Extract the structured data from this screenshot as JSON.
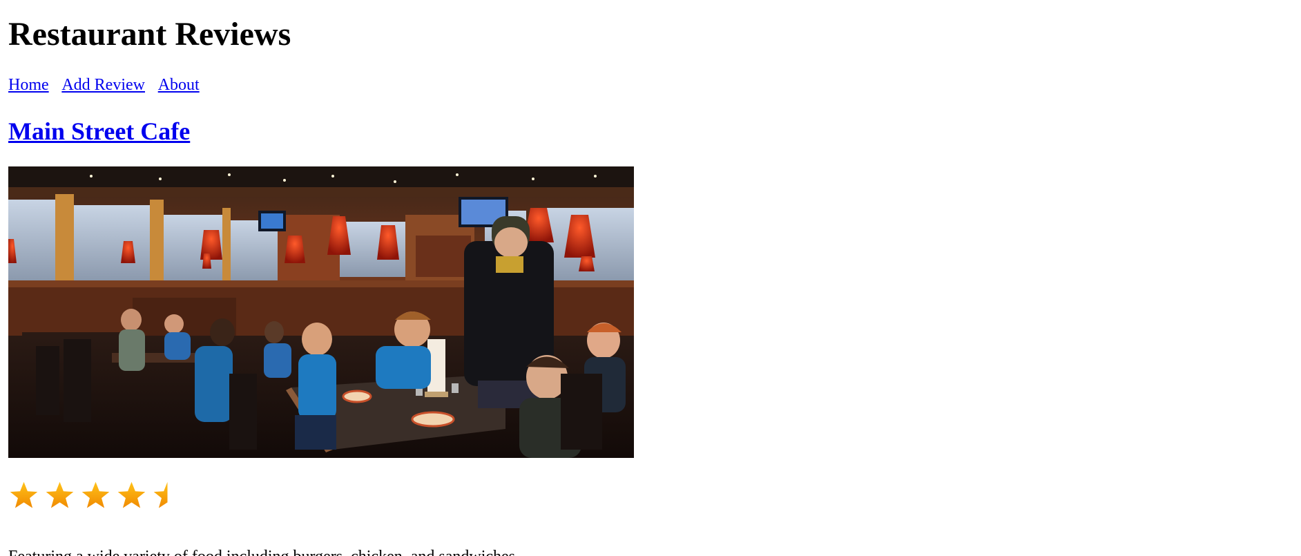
{
  "header": {
    "title": "Restaurant Reviews"
  },
  "nav": {
    "items": [
      {
        "label": "Home"
      },
      {
        "label": "Add Review"
      },
      {
        "label": "About"
      }
    ],
    "link_color": "#0000ee"
  },
  "restaurant": {
    "name": "Main Street Cafe",
    "image_subject": "restaurant-interior-photo",
    "rating": {
      "value": 4.5,
      "max": 5,
      "star_color": "#ffa500",
      "icon": "star-icon"
    },
    "description": "Featuring a wide variety of food including burgers, chicken, and sandwiches."
  }
}
